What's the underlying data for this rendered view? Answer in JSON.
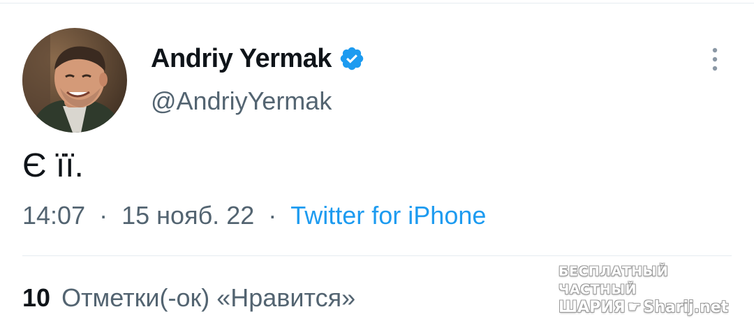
{
  "author": {
    "display_name": "Andriy Yermak",
    "handle": "@AndriyYermak",
    "verified": true,
    "verified_color": "#1d9bf0"
  },
  "tweet": {
    "text": "Є її."
  },
  "meta": {
    "time": "14:07",
    "separator": "·",
    "date": "15 нояб. 22",
    "source": "Twitter for iPhone",
    "source_color": "#1d9bf0"
  },
  "engagement": {
    "likes_count": "10",
    "likes_label": "Отметки(-ок) «Нравится»"
  },
  "watermark": {
    "line1": "БЕСПЛАТНЫЙ ЧАСТНЫЙ",
    "line2_left": "ШАРИЯ",
    "line2_right": "Sharij.net",
    "hand_icon": "pointing-hand-icon"
  },
  "icons": {
    "more": "more-vertical-icon",
    "verified": "verified-badge-icon",
    "avatar": "avatar-photo"
  }
}
